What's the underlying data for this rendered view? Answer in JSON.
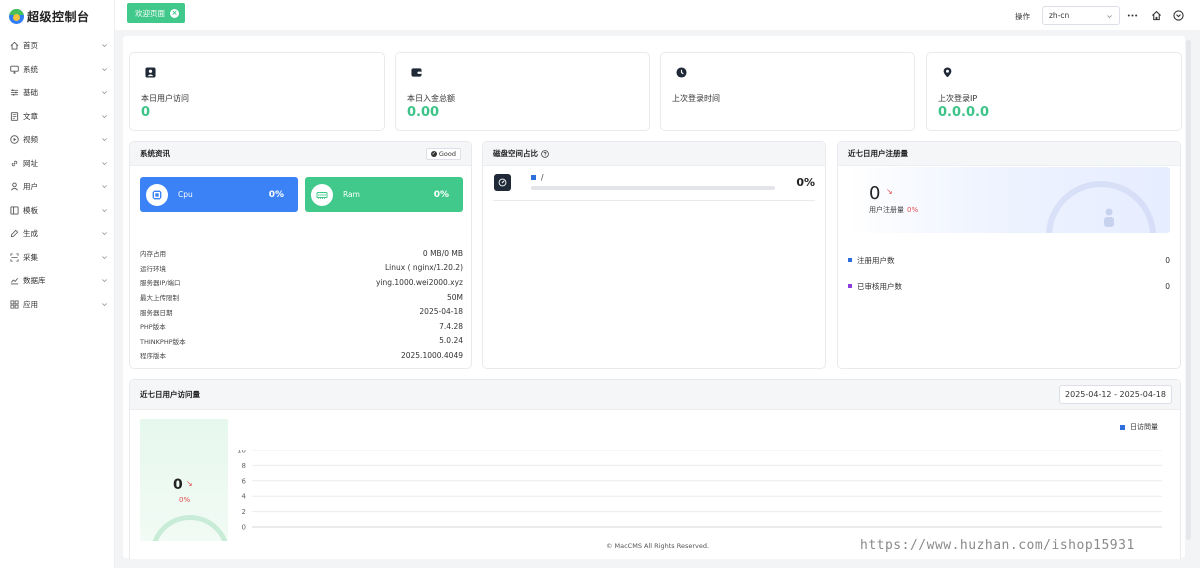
{
  "app": {
    "title": "超级控制台"
  },
  "sidebar": {
    "items": [
      {
        "label": "首页",
        "icon": "home-icon"
      },
      {
        "label": "系统",
        "icon": "monitor-icon"
      },
      {
        "label": "基础",
        "icon": "sliders-icon"
      },
      {
        "label": "文章",
        "icon": "article-icon"
      },
      {
        "label": "视频",
        "icon": "play-circle-icon"
      },
      {
        "label": "网址",
        "icon": "link-icon"
      },
      {
        "label": "用户",
        "icon": "user-icon"
      },
      {
        "label": "模板",
        "icon": "layout-icon"
      },
      {
        "label": "生成",
        "icon": "edit-icon"
      },
      {
        "label": "采集",
        "icon": "scan-icon"
      },
      {
        "label": "数据库",
        "icon": "chart-line-icon"
      },
      {
        "label": "应用",
        "icon": "apps-icon"
      }
    ]
  },
  "topbar": {
    "active_tab": "欢迎页面",
    "operation_label": "操作",
    "language_value": "zh-cn"
  },
  "stats": [
    {
      "label": "本日用户访问",
      "value": "0",
      "icon": "user-icon"
    },
    {
      "label": "本日入金总额",
      "value": "0.00",
      "icon": "wallet-icon"
    },
    {
      "label": "上次登录时间",
      "value": "",
      "icon": "clock-icon"
    },
    {
      "label": "上次登录IP",
      "value": "0.0.0.0",
      "icon": "location-icon"
    }
  ],
  "system": {
    "title": "系统资讯",
    "status_badge": "Good",
    "cpu": {
      "name": "Cpu",
      "percent": "0%",
      "color": "#3b82f6"
    },
    "ram": {
      "name": "Ram",
      "percent": "0%",
      "color": "#40c98a"
    },
    "info": [
      {
        "key": "内存占用",
        "value": "0 MB/0 MB"
      },
      {
        "key": "运行环境",
        "value": "Linux ( nginx/1.20.2)"
      },
      {
        "key": "服务器IP/端口",
        "value": "ying.1000.wei2000.xyz"
      },
      {
        "key": "最大上传限制",
        "value": "50M"
      },
      {
        "key": "服务器日期",
        "value": "2025-04-18"
      },
      {
        "key": "PHP版本",
        "value": "7.4.28"
      },
      {
        "key": "THINKPHP版本",
        "value": "5.0.24"
      },
      {
        "key": "程序版本",
        "value": "2025.1000.4049"
      }
    ]
  },
  "disk": {
    "title": "磁盘空间占比",
    "entries": [
      {
        "name": "/",
        "percent": "0%",
        "fill": 0
      }
    ]
  },
  "registrations": {
    "title": "近七日用户注册量",
    "value": "0",
    "trend": "↘",
    "sub_label": "用户注册量",
    "sub_percent": "0%",
    "legend": [
      {
        "label": "注册用户数",
        "count": "0",
        "color": "#2f6fdb"
      },
      {
        "label": "已审核用户数",
        "count": "0",
        "color": "#8b3fd9"
      }
    ]
  },
  "visits": {
    "title": "近七日用户访问量",
    "date_range": "2025-04-12 - 2025-04-18",
    "value": "0",
    "trend": "↘",
    "percent": "0%"
  },
  "chart_data": {
    "type": "line",
    "series": [
      {
        "name": "日访問量",
        "values": []
      }
    ],
    "yticks": [
      0,
      2,
      4,
      6,
      8,
      10
    ],
    "ylim": [
      0,
      10
    ],
    "legend_position": "top-right",
    "grid": true,
    "color": "#2f6fdb"
  },
  "footer": {
    "text": "© MacCMS All Rights Reserved."
  },
  "watermark": {
    "text": "https://www.huzhan.com/ishop15931"
  }
}
